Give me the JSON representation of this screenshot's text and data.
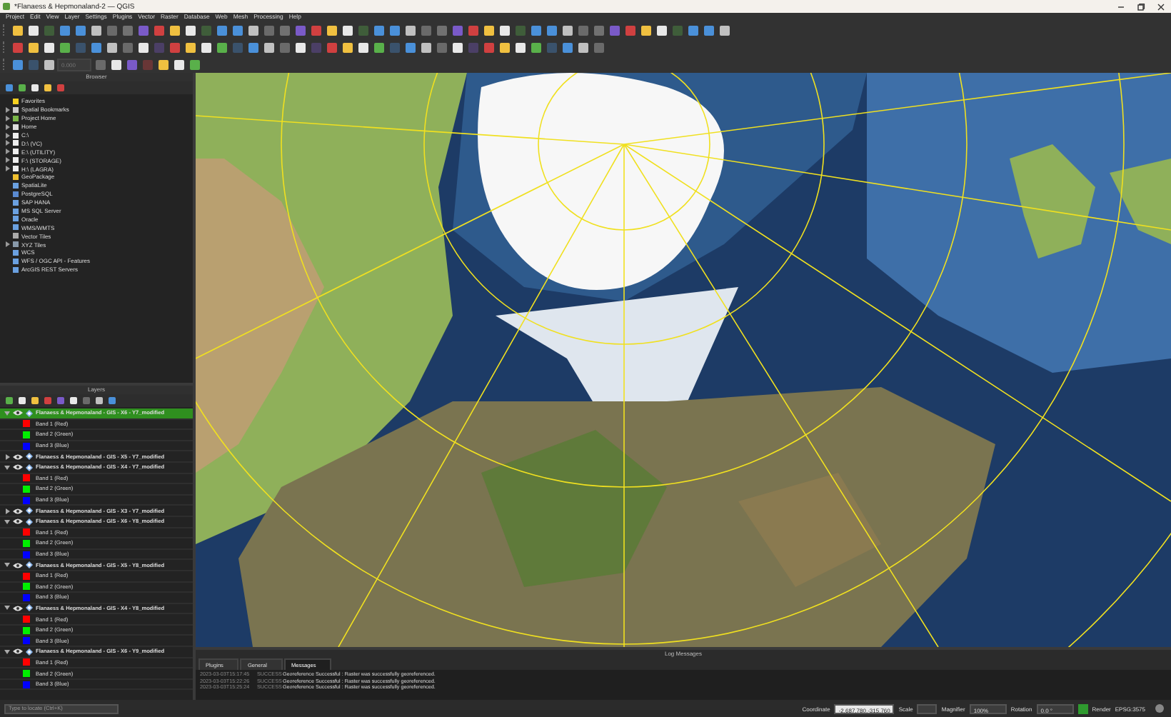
{
  "window": {
    "title": "*Flanaess & Hepmonaland-2 — QGIS"
  },
  "menu": [
    "Project",
    "Edit",
    "View",
    "Layer",
    "Settings",
    "Plugins",
    "Vector",
    "Raster",
    "Database",
    "Web",
    "Mesh",
    "Processing",
    "Help"
  ],
  "toolbar_3": {
    "spin_value": "0.000"
  },
  "browser": {
    "title": "Browser",
    "items": [
      {
        "label": "Favorites",
        "expandable": false
      },
      {
        "label": "Spatial Bookmarks",
        "expandable": true
      },
      {
        "label": "Project Home",
        "expandable": true
      },
      {
        "label": "Home",
        "expandable": true
      },
      {
        "label": "C:\\",
        "expandable": true
      },
      {
        "label": "D:\\ (VC)",
        "expandable": true
      },
      {
        "label": "E:\\ (UTILITY)",
        "expandable": true
      },
      {
        "label": "F:\\ (STORAGE)",
        "expandable": true
      },
      {
        "label": "H:\\ (LAGRA)",
        "expandable": true
      },
      {
        "label": "GeoPackage",
        "expandable": false
      },
      {
        "label": "SpatiaLite",
        "expandable": false
      },
      {
        "label": "PostgreSQL",
        "expandable": false
      },
      {
        "label": "SAP HANA",
        "expandable": false
      },
      {
        "label": "MS SQL Server",
        "expandable": false
      },
      {
        "label": "Oracle",
        "expandable": false
      },
      {
        "label": "WMS/WMTS",
        "expandable": false
      },
      {
        "label": "Vector Tiles",
        "expandable": false
      },
      {
        "label": "XYZ Tiles",
        "expandable": true
      },
      {
        "label": "WCS",
        "expandable": false
      },
      {
        "label": "WFS / OGC API - Features",
        "expandable": false
      },
      {
        "label": "ArcGIS REST Servers",
        "expandable": false
      }
    ]
  },
  "layers": {
    "title": "Layers",
    "items": [
      {
        "name": "Flanaess & Hepmonaland - GIS - X6 - Y7_modified",
        "visible": true,
        "selected": true,
        "expanded": true,
        "children": [
          {
            "label": "Band 1 (Red)",
            "color": "#ff0000"
          },
          {
            "label": "Band 2 (Green)",
            "color": "#00ee00"
          },
          {
            "label": "Band 3 (Blue)",
            "color": "#0000ff"
          }
        ]
      },
      {
        "name": "Flanaess & Hepmonaland - GIS - X5 - Y7_modified",
        "visible": true,
        "selected": false,
        "expanded": false
      },
      {
        "name": "Flanaess & Hepmonaland - GIS - X4 - Y7_modified",
        "visible": true,
        "selected": false,
        "expanded": true,
        "children": [
          {
            "label": "Band 1 (Red)",
            "color": "#ff0000"
          },
          {
            "label": "Band 2 (Green)",
            "color": "#00ee00"
          },
          {
            "label": "Band 3 (Blue)",
            "color": "#0000ff"
          }
        ]
      },
      {
        "name": "Flanaess & Hepmonaland - GIS - X3 - Y7_modified",
        "visible": true,
        "selected": false,
        "expanded": false
      },
      {
        "name": "Flanaess & Hepmonaland - GIS - X6 - Y8_modified",
        "visible": true,
        "selected": false,
        "expanded": true,
        "children": [
          {
            "label": "Band 1 (Red)",
            "color": "#ff0000"
          },
          {
            "label": "Band 2 (Green)",
            "color": "#00ee00"
          },
          {
            "label": "Band 3 (Blue)",
            "color": "#0000ff"
          }
        ]
      },
      {
        "name": "Flanaess & Hepmonaland - GIS - X5 - Y8_modified",
        "visible": true,
        "selected": false,
        "expanded": true,
        "children": [
          {
            "label": "Band 1 (Red)",
            "color": "#ff0000"
          },
          {
            "label": "Band 2 (Green)",
            "color": "#00ee00"
          },
          {
            "label": "Band 3 (Blue)",
            "color": "#0000ff"
          }
        ]
      },
      {
        "name": "Flanaess & Hepmonaland - GIS - X4 - Y8_modified",
        "visible": true,
        "selected": false,
        "expanded": true,
        "children": [
          {
            "label": "Band 1 (Red)",
            "color": "#ff0000"
          },
          {
            "label": "Band 2 (Green)",
            "color": "#00ee00"
          },
          {
            "label": "Band 3 (Blue)",
            "color": "#0000ff"
          }
        ]
      },
      {
        "name": "Flanaess & Hepmonaland - GIS - X6 - Y9_modified",
        "visible": true,
        "selected": false,
        "expanded": true,
        "children": [
          {
            "label": "Band 1 (Red)",
            "color": "#ff0000"
          },
          {
            "label": "Band 2 (Green)",
            "color": "#00ee00"
          },
          {
            "label": "Band 3 (Blue)",
            "color": "#0000ff"
          }
        ]
      }
    ]
  },
  "locator": {
    "placeholder": "Type to locate (Ctrl+K)"
  },
  "log": {
    "title": "Log Messages",
    "tabs": [
      {
        "label": "Plugins",
        "selected": false
      },
      {
        "label": "General",
        "selected": false
      },
      {
        "label": "Messages",
        "selected": true
      }
    ],
    "messages": [
      {
        "time": "2023-03-03T15:17:45",
        "level": "SUCCESS",
        "text": "Georeference Successful : Raster was successfully georeferenced."
      },
      {
        "time": "2023-03-03T15:22:26",
        "level": "SUCCESS",
        "text": "Georeference Successful : Raster was successfully georeferenced."
      },
      {
        "time": "2023-03-03T15:25:24",
        "level": "SUCCESS",
        "text": "Georeference Successful : Raster was successfully georeferenced."
      }
    ]
  },
  "status_bar": {
    "coordinate_label": "Coordinate",
    "coordinate": "-2,687,780,-315,760",
    "scale_label": "Scale",
    "magnifier_label": "Magnifier",
    "magnifier": "100%",
    "rotation_label": "Rotation",
    "rotation": "0.0 °",
    "render_label": "Render",
    "render": true,
    "crs": "EPSG:3575"
  }
}
